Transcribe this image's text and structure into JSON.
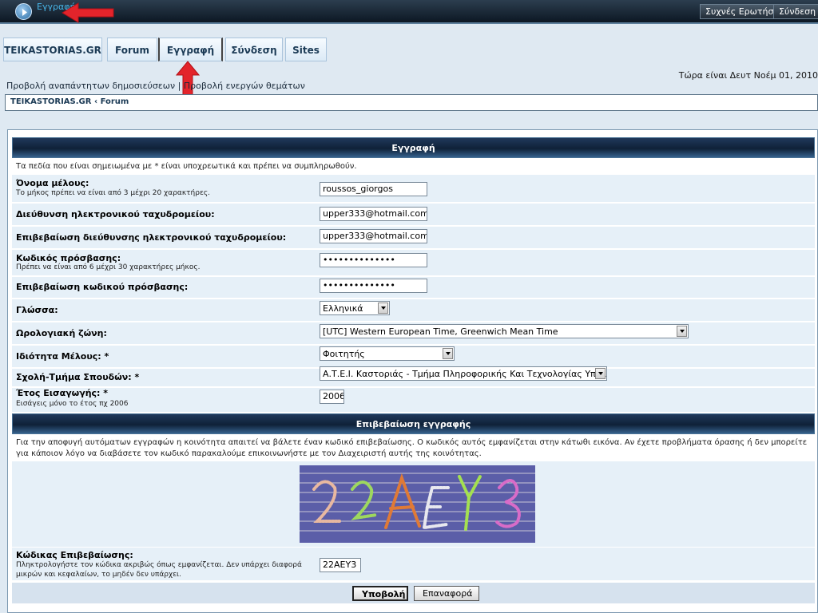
{
  "topbar": {
    "brand": "Εγγραφή",
    "faq_label": "Συχνές Ερωτήσεις",
    "login_label": "Σύνδεση"
  },
  "tabs": [
    {
      "label": "TEIKASTORIAS.GR"
    },
    {
      "label": "Forum"
    },
    {
      "label": "Εγγραφή"
    },
    {
      "label": "Σύνδεση"
    },
    {
      "label": "Sites"
    }
  ],
  "datetime": "Τώρα είναι Δευτ Νοέμ 01, 2010",
  "navlinks": {
    "unanswered": "Προβολή αναπάντητων δημοσιεύσεων",
    "separator": " | ",
    "active": "Προβολή ενεργών θεμάτων"
  },
  "breadcrumb": {
    "root": "TEIKASTORIAS.GR",
    "sep": " ‹ ",
    "current": "Forum"
  },
  "form": {
    "header": "Εγγραφή",
    "required_note": "Τα πεδία που είναι σημειωμένα με * είναι υποχρεωτικά και πρέπει να συμπληρωθούν.",
    "username_label": "Όνομα μέλους:",
    "username_hint": "Το μήκος πρέπει να είναι από 3 μέχρι 20 χαρακτήρες.",
    "username_value": "roussos_giorgos",
    "email_label": "Διεύθυνση ηλεκτρονικού ταχυδρομείου:",
    "email_value": "upper333@hotmail.com",
    "email_confirm_label": "Επιβεβαίωση διεύθυνσης ηλεκτρονικού ταχυδρομείου:",
    "email_confirm_value": "upper333@hotmail.com",
    "password_label": "Κωδικός πρόσβασης:",
    "password_hint": "Πρέπει να είναι από 6 μέχρι 30 χαρακτήρες μήκος.",
    "password_value": "••••••••••••••",
    "password_confirm_label": "Επιβεβαίωση κωδικού πρόσβασης:",
    "password_confirm_value": "••••••••••••••",
    "language_label": "Γλώσσα:",
    "language_value": "Ελληνικά",
    "timezone_label": "Ωρολογιακή ζώνη:",
    "timezone_value": "[UTC] Western European Time, Greenwich Mean Time",
    "member_type_label": "Ιδιότητα Μέλους: *",
    "member_type_value": "Φοιτητής",
    "department_label": "Σχολή-Τμήμα Σπουδών: *",
    "department_value": "Α.Τ.Ε.Ι. Καστοριάς - Τμήμα Πληροφορικής Και Τεχνολογίας Υπολογιστών",
    "year_label": "Έτος Εισαγωγής: *",
    "year_hint": "Εισάγεις μόνο το έτος πχ 2006",
    "year_value": "2006"
  },
  "confirm": {
    "header": "Επιβεβαίωση εγγραφής",
    "note": "Για την αποφυγή αυτόματων εγγραφών η κοινότητα απαιτεί να βάλετε έναν κωδικό επιβεβαίωσης. Ο κωδικός αυτός εμφανίζεται στην κάτωθι εικόνα. Αν έχετε προβλήματα όρασης ή δεν μπορείτε για κάποιον λόγο να διαβάσετε τον κωδικό παρακαλούμε επικοινωνήστε με τον Διαχειριστή αυτής της κοινότητας.",
    "code_label": "Κώδικας Επιβεβαίωσης:",
    "code_hint": "Πληκτρολογήστε τον κώδικα ακριβώς όπως εμφανίζεται. Δεν υπάρχει διαφορά μικρών και κεφαλαίων, το μηδέν δεν υπάρχει.",
    "code_value": "22AEY3",
    "captcha_chars": [
      "2",
      "2",
      "A",
      "E",
      "Y",
      "3"
    ]
  },
  "buttons": {
    "submit": "Υποβολή",
    "reset": "Επαναφορά"
  },
  "colors": {
    "accent": "#48b6e8",
    "header": "#0f2138",
    "row": "#e6f0f8",
    "arrow": "#e3242b",
    "captcha_bg": "#5b5ea8"
  }
}
